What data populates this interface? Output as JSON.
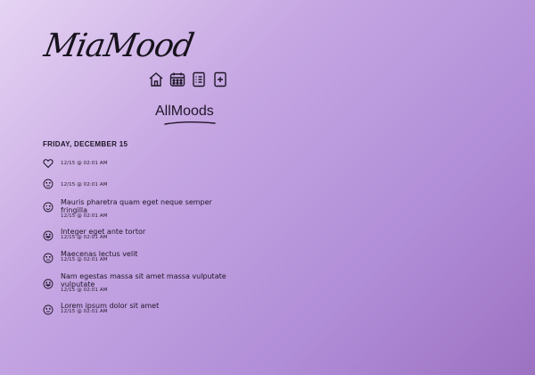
{
  "app": {
    "logo_text": "MiaMood",
    "section_title": "AllMoods"
  },
  "nav": {
    "icons": [
      "home-icon",
      "calendar-icon",
      "list-icon",
      "add-icon"
    ]
  },
  "feed": {
    "date_heading": "FRIDAY, DECEMBER 15",
    "entries": [
      {
        "icon": "heart-icon",
        "note": "",
        "time": "12/15 @ 02:01 AM"
      },
      {
        "icon": "neutral-face-icon",
        "note": "",
        "time": "12/15 @ 02:01 AM"
      },
      {
        "icon": "wink-face-icon",
        "note": "Mauris pharetra quam eget neque semper fringilla",
        "time": "12/15 @ 02:01 AM"
      },
      {
        "icon": "smile-face-icon",
        "note": "Integer eget ante tortor",
        "time": "12/15 @ 02:01 AM"
      },
      {
        "icon": "neutral-face-icon",
        "note": "Maecenas lectus velit",
        "time": "12/15 @ 02:01 AM"
      },
      {
        "icon": "smile-face-icon",
        "note": "Nam egestas massa sit amet massa vulputate vulputate",
        "time": "12/15 @ 02:01 AM"
      },
      {
        "icon": "neutral-face-icon",
        "note": "Lorem ipsum dolor sit amet",
        "time": "12/15 @ 02:01 AM"
      }
    ]
  }
}
